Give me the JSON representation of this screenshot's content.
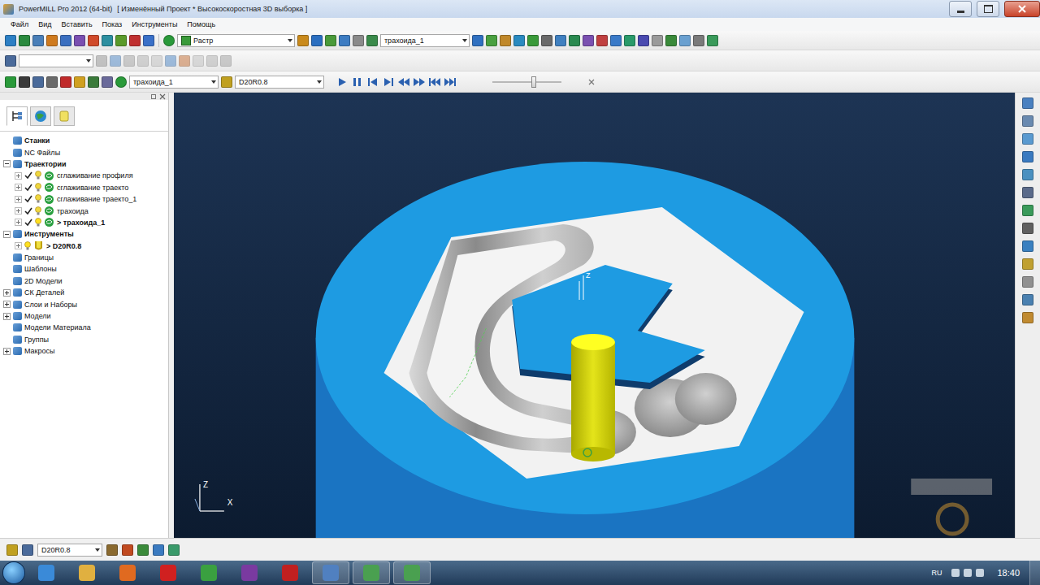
{
  "window": {
    "title": "PowerMILL Pro 2012 (64-bit)",
    "document": "[ Изменённый Проект * Высокоскоростная 3D выборка ]"
  },
  "menu": [
    "Файл",
    "Вид",
    "Вставить",
    "Показ",
    "Инструменты",
    "Помощь"
  ],
  "toolbar": {
    "draw_mode": "Растр",
    "toolpath": "трахоида_1"
  },
  "simulation": {
    "toolpath": "трахоида_1",
    "tool": "D20R0.8",
    "speed_level": 0.6
  },
  "panel_tabs": [
    {
      "selected": true
    },
    {
      "selected": false
    },
    {
      "selected": false
    }
  ],
  "tree": [
    {
      "label": "Станки",
      "kind": "folder",
      "depth": 0,
      "has_children": false,
      "expanded": false
    },
    {
      "label": "NC Файлы",
      "kind": "folder",
      "depth": 0,
      "has_children": false,
      "expanded": false
    },
    {
      "label": "Траектории",
      "kind": "folder",
      "depth": 0,
      "has_children": true,
      "expanded": true
    },
    {
      "label": "сглаживание профиля",
      "kind": "toolpath",
      "depth": 1,
      "checked": true,
      "active": false
    },
    {
      "label": "сглаживание траекто",
      "kind": "toolpath",
      "depth": 1,
      "checked": true,
      "active": false
    },
    {
      "label": "сглаживание траекто_1",
      "kind": "toolpath",
      "depth": 1,
      "checked": true,
      "active": false
    },
    {
      "label": "трахоида",
      "kind": "toolpath",
      "depth": 1,
      "checked": true,
      "active": false
    },
    {
      "label": "> трахоида_1",
      "kind": "toolpath",
      "depth": 1,
      "checked": true,
      "active": true
    },
    {
      "label": "Инструменты",
      "kind": "folder",
      "depth": 0,
      "has_children": true,
      "expanded": true
    },
    {
      "label": "> D20R0.8",
      "kind": "tool",
      "depth": 1,
      "checked": false,
      "active": true
    },
    {
      "label": "Границы",
      "kind": "folder",
      "depth": 0,
      "has_children": false,
      "expanded": false
    },
    {
      "label": "Шаблоны",
      "kind": "folder",
      "depth": 0,
      "has_children": false,
      "expanded": false
    },
    {
      "label": "2D Модели",
      "kind": "folder",
      "depth": 0,
      "has_children": false,
      "expanded": false
    },
    {
      "label": "СК Деталей",
      "kind": "folder",
      "depth": 0,
      "has_children": true,
      "expanded": false
    },
    {
      "label": "Слои и Наборы",
      "kind": "folder",
      "depth": 0,
      "has_children": true,
      "expanded": false
    },
    {
      "label": "Модели",
      "kind": "folder",
      "depth": 0,
      "has_children": true,
      "expanded": false
    },
    {
      "label": "Модели Материала",
      "kind": "folder",
      "depth": 0,
      "has_children": false,
      "expanded": false
    },
    {
      "label": "Группы",
      "kind": "folder",
      "depth": 0,
      "has_children": false,
      "expanded": false
    },
    {
      "label": "Макросы",
      "kind": "folder",
      "depth": 0,
      "has_children": true,
      "expanded": false
    }
  ],
  "viewport": {
    "axis_z": "Z",
    "axis_x": "X",
    "tool_axis": "Z"
  },
  "status_bar": {
    "tool": "D20R0.8"
  },
  "taskbar": {
    "language": "RU",
    "time": "18:40"
  }
}
